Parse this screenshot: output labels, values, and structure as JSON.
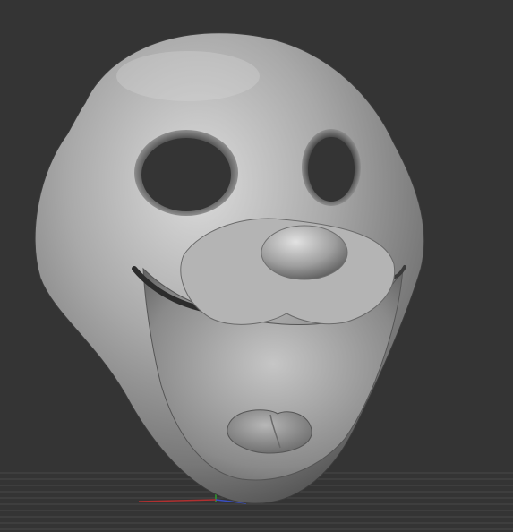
{
  "viewport": {
    "background_color": "#343434",
    "grid_color": "#4a4a4a",
    "model_color": "#9a9a9a",
    "model_highlight_color": "#d6d6d6",
    "model_shadow_color": "#3a3a3a",
    "axis_x_color": "#b03030",
    "axis_y_color": "#2f9a2f",
    "axis_z_color": "#3a4fc0",
    "model": {
      "name": "mask-sculpt",
      "features": [
        "left-eye-hole",
        "right-eye-hole",
        "nose",
        "smiling-mouth",
        "tongue"
      ]
    }
  }
}
